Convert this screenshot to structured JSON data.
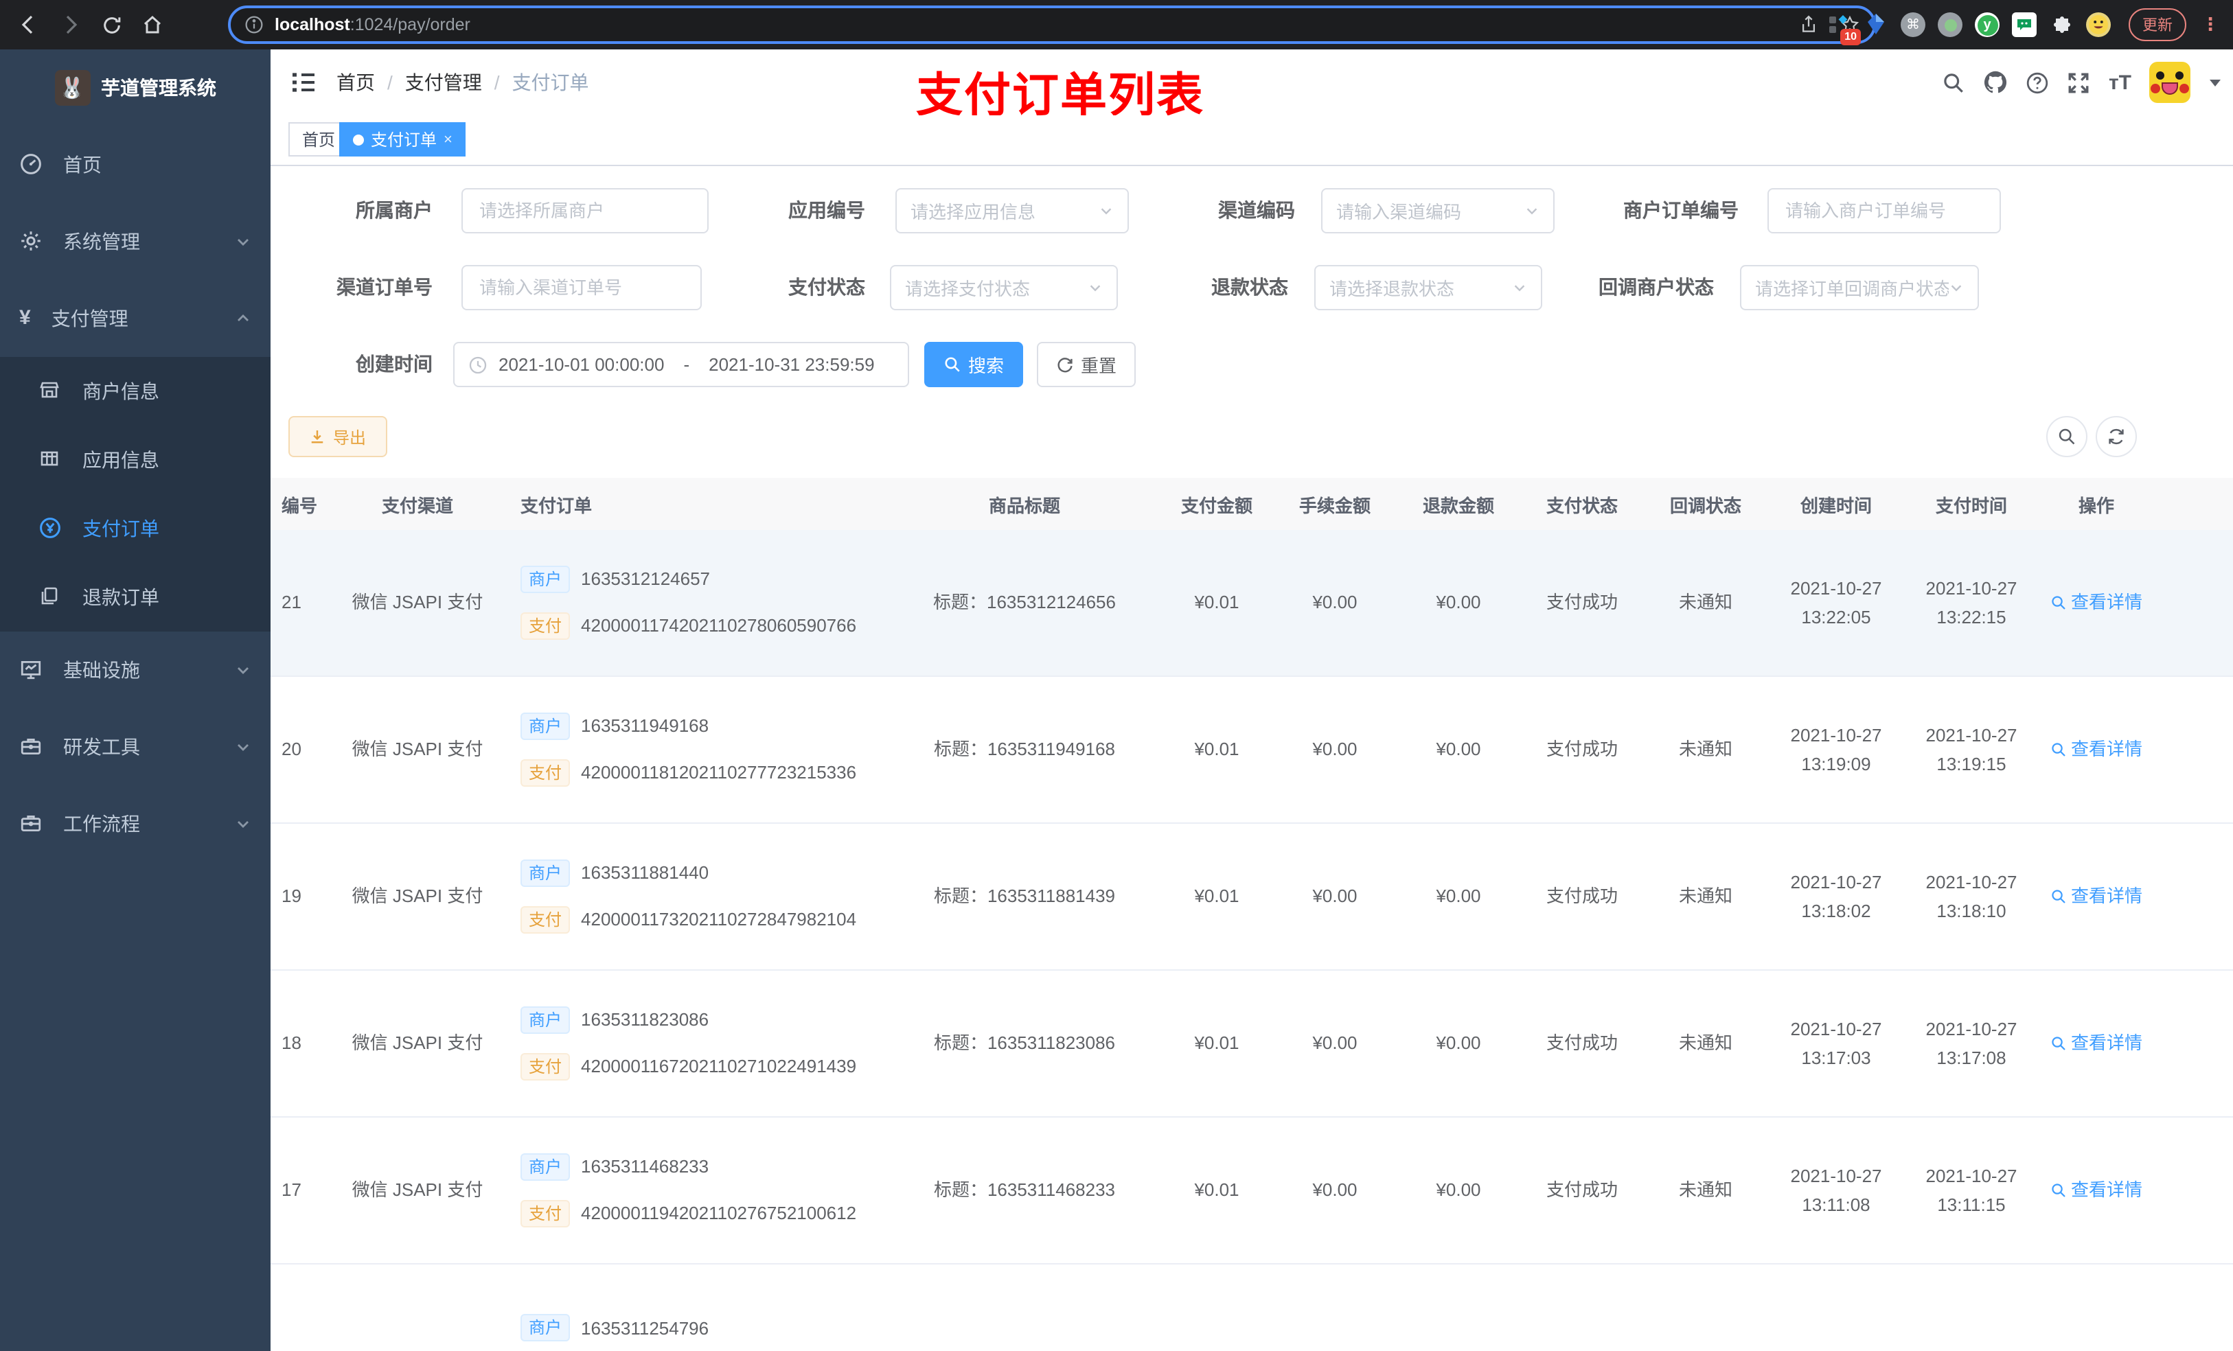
{
  "browser": {
    "url_host": "localhost",
    "url_path": ":1024/pay/order",
    "update_label": "更新",
    "extension_badge": "10"
  },
  "app": {
    "title": "芋道管理系统"
  },
  "sidebar": {
    "items": [
      {
        "label": "首页"
      },
      {
        "label": "系统管理"
      },
      {
        "label": "支付管理"
      }
    ],
    "subitems": [
      {
        "label": "商户信息"
      },
      {
        "label": "应用信息"
      },
      {
        "label": "支付订单"
      },
      {
        "label": "退款订单"
      }
    ],
    "items_bottom": [
      {
        "label": "基础设施"
      },
      {
        "label": "研发工具"
      },
      {
        "label": "工作流程"
      }
    ]
  },
  "header": {
    "breadcrumb": [
      "首页",
      "支付管理",
      "支付订单"
    ],
    "annotation": "支付订单列表"
  },
  "tabs": [
    {
      "label": "首页"
    },
    {
      "label": "支付订单"
    }
  ],
  "filters": {
    "fields": [
      {
        "label": "所属商户",
        "placeholder": "请选择所属商户"
      },
      {
        "label": "应用编号",
        "placeholder": "请选择应用信息"
      },
      {
        "label": "渠道编码",
        "placeholder": "请输入渠道编码"
      },
      {
        "label": "商户订单编号",
        "placeholder": "请输入商户订单编号"
      },
      {
        "label": "渠道订单号",
        "placeholder": "请输入渠道订单号"
      },
      {
        "label": "支付状态",
        "placeholder": "请选择支付状态"
      },
      {
        "label": "退款状态",
        "placeholder": "请选择退款状态"
      },
      {
        "label": "回调商户状态",
        "placeholder": "请选择订单回调商户状态"
      }
    ],
    "date_label": "创建时间",
    "date_start": "2021-10-01 00:00:00",
    "date_end": "2021-10-31 23:59:59",
    "search_label": "搜索",
    "reset_label": "重置"
  },
  "toolbar": {
    "export_label": "导出"
  },
  "table": {
    "columns": [
      "编号",
      "支付渠道",
      "支付订单",
      "商品标题",
      "支付金额",
      "手续金额",
      "退款金额",
      "支付状态",
      "回调状态",
      "创建时间",
      "支付时间",
      "操作"
    ],
    "tag_merchant": "商户",
    "tag_pay": "支付",
    "title_prefix": "标题：",
    "action_label": "查看详情",
    "rows": [
      {
        "id": "21",
        "channel": "微信 JSAPI 支付",
        "merchant_no": "1635312124657",
        "pay_no": "4200001174202110278060590766",
        "title": "1635312124656",
        "amount": "¥0.01",
        "fee": "¥0.00",
        "refund": "¥0.00",
        "status": "支付成功",
        "notify": "未通知",
        "created_date": "2021-10-27",
        "created_time": "13:22:05",
        "paid_date": "2021-10-27",
        "paid_time": "13:22:15"
      },
      {
        "id": "20",
        "channel": "微信 JSAPI 支付",
        "merchant_no": "1635311949168",
        "pay_no": "4200001181202110277723215336",
        "title": "1635311949168",
        "amount": "¥0.01",
        "fee": "¥0.00",
        "refund": "¥0.00",
        "status": "支付成功",
        "notify": "未通知",
        "created_date": "2021-10-27",
        "created_time": "13:19:09",
        "paid_date": "2021-10-27",
        "paid_time": "13:19:15"
      },
      {
        "id": "19",
        "channel": "微信 JSAPI 支付",
        "merchant_no": "1635311881440",
        "pay_no": "4200001173202110272847982104",
        "title": "1635311881439",
        "amount": "¥0.01",
        "fee": "¥0.00",
        "refund": "¥0.00",
        "status": "支付成功",
        "notify": "未通知",
        "created_date": "2021-10-27",
        "created_time": "13:18:02",
        "paid_date": "2021-10-27",
        "paid_time": "13:18:10"
      },
      {
        "id": "18",
        "channel": "微信 JSAPI 支付",
        "merchant_no": "1635311823086",
        "pay_no": "4200001167202110271022491439",
        "title": "1635311823086",
        "amount": "¥0.01",
        "fee": "¥0.00",
        "refund": "¥0.00",
        "status": "支付成功",
        "notify": "未通知",
        "created_date": "2021-10-27",
        "created_time": "13:17:03",
        "paid_date": "2021-10-27",
        "paid_time": "13:17:08"
      },
      {
        "id": "17",
        "channel": "微信 JSAPI 支付",
        "merchant_no": "1635311468233",
        "pay_no": "4200001194202110276752100612",
        "title": "1635311468233",
        "amount": "¥0.01",
        "fee": "¥0.00",
        "refund": "¥0.00",
        "status": "支付成功",
        "notify": "未通知",
        "created_date": "2021-10-27",
        "created_time": "13:11:08",
        "paid_date": "2021-10-27",
        "paid_time": "13:11:15"
      }
    ],
    "partial_row": {
      "merchant_no": "1635311254796"
    }
  }
}
